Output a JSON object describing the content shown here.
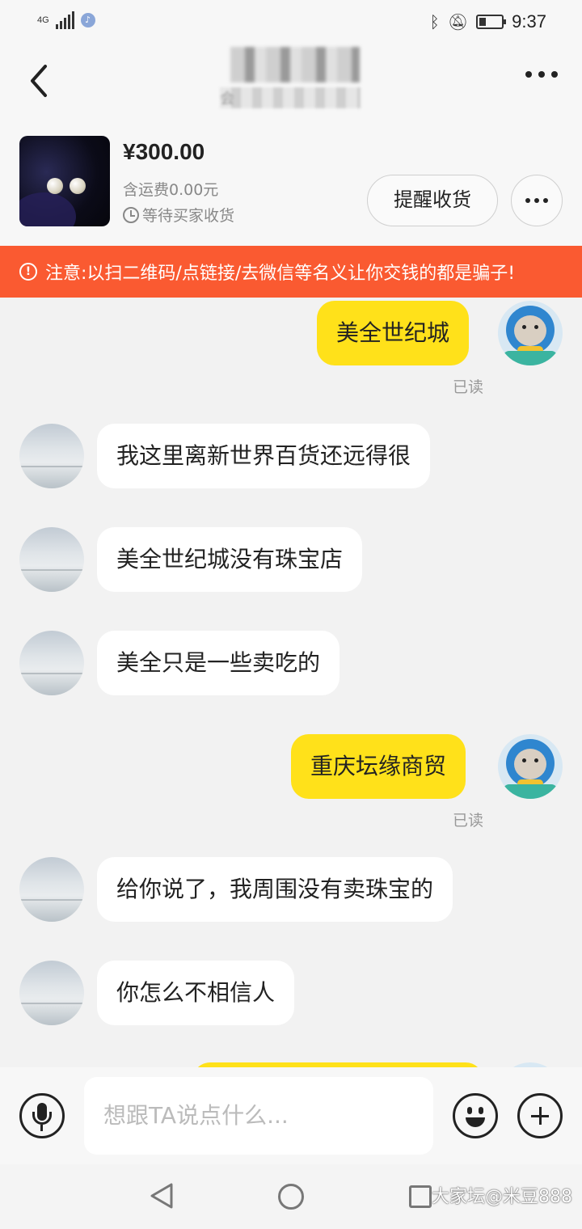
{
  "status_bar": {
    "network_type": "4G",
    "time": "9:37"
  },
  "header": {
    "title": "",
    "subtitle": "会"
  },
  "product": {
    "price": "¥300.00",
    "shipping": "含运费0.00元",
    "status": "等待买家收货",
    "remind_button": "提醒收货"
  },
  "warning": {
    "text": "注意:以扫二维码/点链接/去微信等名义让你交钱的都是骗子!"
  },
  "messages": [
    {
      "sender": "me",
      "text": "美全世纪城",
      "read": "已读"
    },
    {
      "sender": "other",
      "text": "我这里离新世界百货还远得很"
    },
    {
      "sender": "other",
      "text": "美全世纪城没有珠宝店"
    },
    {
      "sender": "other",
      "text": "美全只是一些卖吃的"
    },
    {
      "sender": "me",
      "text": "重庆坛缘商贸",
      "read": "已读"
    },
    {
      "sender": "other",
      "text": "给你说了，我周围没有卖珠宝的"
    },
    {
      "sender": "other",
      "text": "你怎么不相信人"
    }
  ],
  "input": {
    "placeholder": "想跟TA说点什么..."
  },
  "watermark": "大家坛@米豆888",
  "colors": {
    "my_bubble": "#ffe11a",
    "their_bubble": "#ffffff",
    "warning_bg": "#fa5a31",
    "background": "#f2f2f2"
  },
  "icons": [
    "back-icon",
    "more-icon",
    "clock-icon",
    "warning-icon",
    "voice-icon",
    "emoji-icon",
    "plus-icon",
    "bluetooth-icon",
    "mute-icon",
    "battery-icon",
    "music-icon"
  ]
}
